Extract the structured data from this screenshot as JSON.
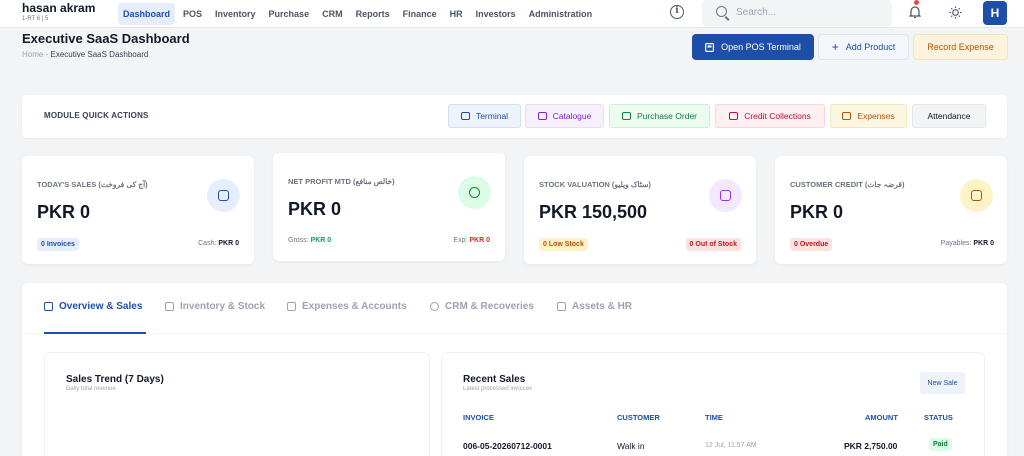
{
  "brand": {
    "name": "hasan akram",
    "sub": "1-RT 6 | 5"
  },
  "nav": {
    "items": [
      "Dashboard",
      "POS",
      "Inventory",
      "Purchase",
      "CRM",
      "Reports",
      "Finance",
      "HR",
      "Investors",
      "Administration"
    ],
    "active": "Dashboard"
  },
  "search": {
    "placeholder": "Search..."
  },
  "avatar": {
    "initial": "H"
  },
  "header": {
    "title": "Executive SaaS Dashboard",
    "breadcrumb_home": "Home",
    "breadcrumb_sep": "-",
    "breadcrumb_current": "Executive SaaS Dashboard",
    "btn_pos": "Open POS Terminal",
    "btn_add": "Add Product",
    "btn_expense": "Record Expense"
  },
  "quick_actions": {
    "title": "MODULE QUICK ACTIONS",
    "items": [
      "Terminal",
      "Catalogue",
      "Purchase Order",
      "Credit Collections",
      "Expenses",
      "Attendance"
    ]
  },
  "kpis": [
    {
      "label": "TODAY'S SALES (آج کی فروخت)",
      "value": "PKR 0",
      "pill": "0 Invoices",
      "foot_label": "Cash:",
      "foot_value": "PKR 0"
    },
    {
      "label": "NET PROFIT MTD (خالص منافع)",
      "value": "PKR 0",
      "gross_label": "Gross:",
      "gross_value": "PKR 0",
      "exp_label": "Exp:",
      "exp_value": "PKR 0"
    },
    {
      "label": "STOCK VALUATION (سٹاک ویلیو)",
      "value": "PKR 150,500",
      "pill": "0 Low Stock",
      "pill2": "0 Out of Stock"
    },
    {
      "label": "CUSTOMER CREDIT (قرضہ جات)",
      "value": "PKR 0",
      "pill": "0 Overdue",
      "foot_label": "Payables:",
      "foot_value": "PKR 0"
    }
  ],
  "tabs": [
    "Overview & Sales",
    "Inventory & Stock",
    "Expenses & Accounts",
    "CRM & Recoveries",
    "Assets & HR"
  ],
  "sales_trend": {
    "title": "Sales Trend (7 Days)",
    "subtitle": "Daily total revenue"
  },
  "recent_sales": {
    "title": "Recent Sales",
    "subtitle": "Latest processed invoices",
    "new_sale": "New Sale",
    "columns": [
      "INVOICE",
      "CUSTOMER",
      "TIME",
      "AMOUNT",
      "STATUS"
    ],
    "rows": [
      {
        "invoice": "006-05-20260712-0001",
        "customer": "Walk in",
        "time": "12 Jul, 11:57 AM",
        "amount": "PKR 2,750.00",
        "status": "Paid"
      }
    ]
  }
}
